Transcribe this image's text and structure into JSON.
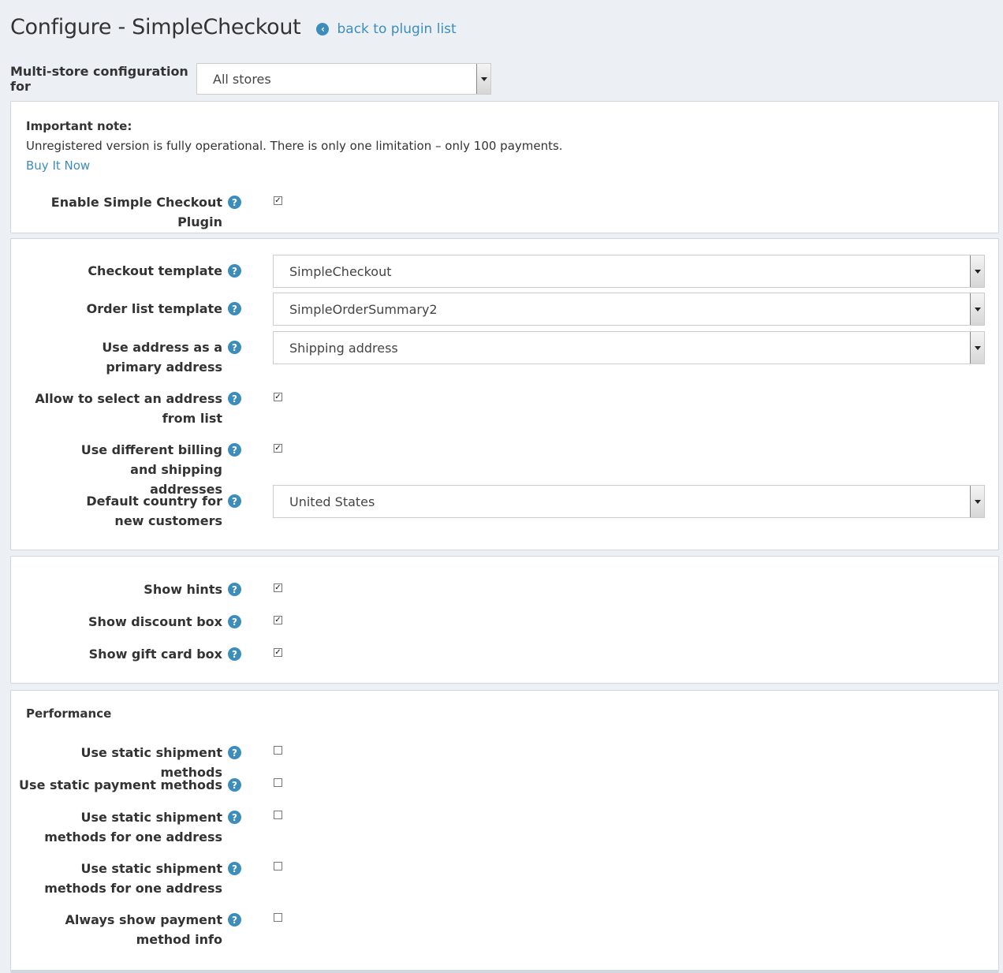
{
  "header": {
    "title": "Configure - SimpleCheckout",
    "back_link": "back to plugin list"
  },
  "multistore": {
    "label": "Multi-store configuration for",
    "selected": "All stores"
  },
  "note": {
    "title": "Important note:",
    "text": "Unregistered version is fully operational. There is only one limitation – only 100 payments.",
    "buy_link": "Buy It Now"
  },
  "enable": {
    "label": "Enable Simple Checkout Plugin",
    "checked": true
  },
  "templates": {
    "checkout_template": {
      "label": "Checkout template",
      "value": "SimpleCheckout"
    },
    "order_list_template": {
      "label": "Order list template",
      "value": "SimpleOrderSummary2"
    },
    "primary_address": {
      "label": "Use address as a primary address",
      "value": "Shipping address"
    },
    "select_address": {
      "label": "Allow to select an address from list",
      "checked": true
    },
    "different_addresses": {
      "label": "Use different billing and shipping addresses",
      "checked": true
    },
    "default_country": {
      "label": "Default country for new customers",
      "value": "United States"
    }
  },
  "display": {
    "show_hints": {
      "label": "Show hints",
      "checked": true
    },
    "show_discount": {
      "label": "Show discount box",
      "checked": true
    },
    "show_giftcard": {
      "label": "Show gift card box",
      "checked": true
    }
  },
  "performance": {
    "title": "Performance",
    "static_shipment": {
      "label": "Use static shipment methods",
      "checked": false
    },
    "static_payment": {
      "label": "Use static payment methods",
      "checked": false
    },
    "static_shipment_one": {
      "label": "Use static shipment methods for one address",
      "checked": false
    },
    "static_shipment_one_2": {
      "label": "Use static shipment methods for one address",
      "checked": false
    },
    "always_payment_info": {
      "label": "Always show payment method info",
      "checked": false
    }
  },
  "icons": {
    "help": "question-circle-icon",
    "back": "arrow-circle-left-icon"
  },
  "colors": {
    "link": "#3c8dbc",
    "background": "#ecf0f5"
  }
}
